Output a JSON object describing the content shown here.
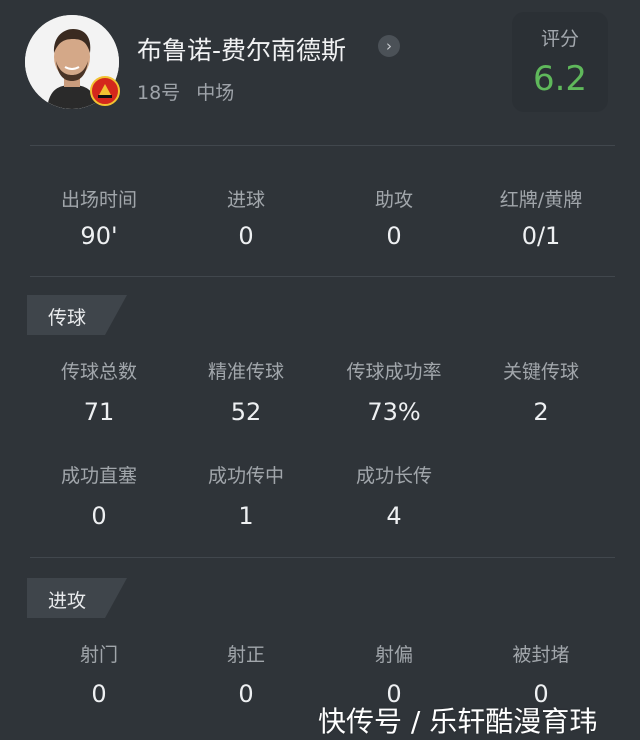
{
  "player": {
    "name": "布鲁诺-费尔南德斯",
    "number": "18号",
    "position": "中场"
  },
  "rating": {
    "label": "评分",
    "value": "6.2",
    "color": "#5fb85b"
  },
  "summary": [
    {
      "label": "出场时间",
      "value": "90'"
    },
    {
      "label": "进球",
      "value": "0"
    },
    {
      "label": "助攻",
      "value": "0"
    },
    {
      "label": "红牌/黄牌",
      "value": "0/1"
    }
  ],
  "passing": {
    "title": "传球",
    "stats": [
      {
        "label": "传球总数",
        "value": "71"
      },
      {
        "label": "精准传球",
        "value": "52"
      },
      {
        "label": "传球成功率",
        "value": "73%"
      },
      {
        "label": "关键传球",
        "value": "2"
      },
      {
        "label": "成功直塞",
        "value": "0"
      },
      {
        "label": "成功传中",
        "value": "1"
      },
      {
        "label": "成功长传",
        "value": "4"
      }
    ]
  },
  "attack": {
    "title": "进攻",
    "stats": [
      {
        "label": "射门",
        "value": "0"
      },
      {
        "label": "射正",
        "value": "0"
      },
      {
        "label": "射偏",
        "value": "0"
      },
      {
        "label": "被封堵",
        "value": "0"
      }
    ]
  },
  "icons": {
    "more": "chevron-right-icon",
    "club": "club-badge-icon"
  },
  "watermark": "快传号 / 乐轩酷漫育玮"
}
